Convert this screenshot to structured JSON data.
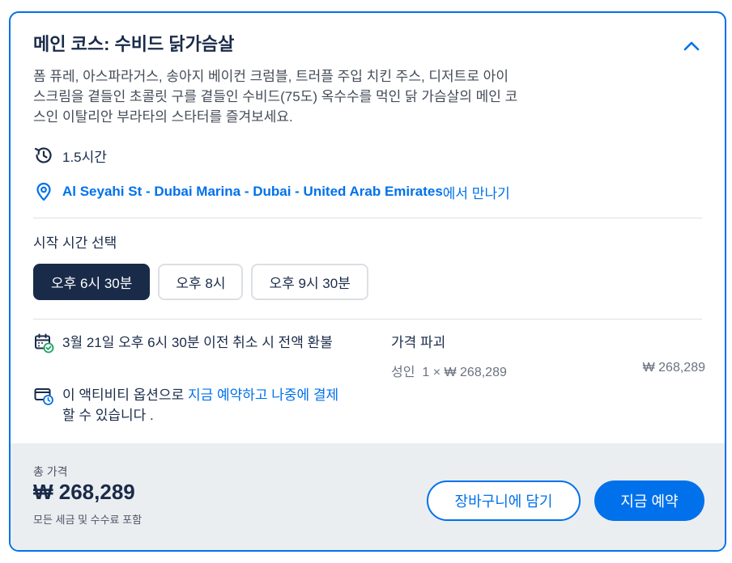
{
  "activity": {
    "title": "메인 코스: 수비드 닭가슴살",
    "description": "폼 퓨레, 아스파라거스, 송아지 베이컨 크럼블, 트러플 주입 치킨 주스, 디저트로 아이스크림을 곁들인 초콜릿 구를 곁들인 수비드(75도) 옥수수를 먹인 닭 가슴살의 메인 코스인 이탈리안 부라타의 스타터를 즐겨보세요.",
    "duration": "1.5시간",
    "meeting_point": "Al Seyahi St - Dubai Marina - Dubai - United Arab Emirates",
    "meeting_suffix": "에서 만나기"
  },
  "start_time": {
    "label": "시작 시간 선택",
    "slots": [
      "오후 6시 30분",
      "오후 8시",
      "오후 9시 30분"
    ],
    "selected_index": 0
  },
  "policies": {
    "cancellation": "3월 21일 오후 6시 30분 이전 취소 시 전액 환불",
    "pay_prefix": "이 액티비티 옵션으로 ",
    "pay_link": "지금 예약하고 나중에 결제",
    "pay_suffix": " 할 수 있습니다 ."
  },
  "price_breakdown": {
    "title": "가격 파괴",
    "row_label": "성인",
    "row_qty": "1 × ₩ 268,289",
    "row_total": "₩ 268,289"
  },
  "footer": {
    "total_label": "총 가격",
    "total_price": "₩ 268,289",
    "tax_note": "모든 세금 및 수수료 포함",
    "cart_button": "장바구니에 담기",
    "book_button": "지금 예약"
  },
  "colors": {
    "accent": "#0071eb",
    "navy": "#1a2b49",
    "success": "#1aa260"
  },
  "icons": {
    "collapse": "chevron-up-icon",
    "duration": "clock-history-icon",
    "location": "map-pin-icon",
    "cancellation": "calendar-check-icon",
    "pay_later": "card-clock-icon"
  }
}
